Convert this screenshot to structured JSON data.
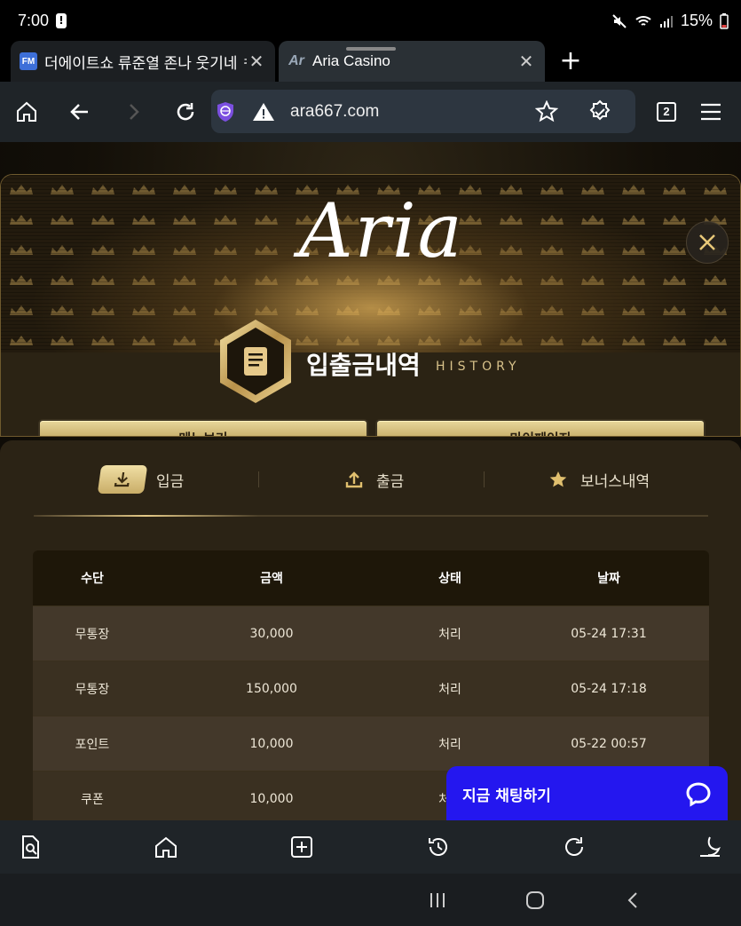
{
  "status_bar": {
    "time": "7:00",
    "battery": "15%",
    "icons": [
      "alert-icon",
      "mute-icon",
      "wifi-icon",
      "signal-icon",
      "battery-icon"
    ]
  },
  "browser": {
    "tabs": [
      {
        "favicon": "FM",
        "title": "더에이트쇼 류준열 존나 웃기네 ㅋ",
        "active": false
      },
      {
        "favicon": "Ar",
        "title": "Aria Casino",
        "active": true
      }
    ],
    "url": "ara667.com",
    "tab_count": "2"
  },
  "page": {
    "logo": "Aria",
    "title": "입출금내역",
    "subtitle": "HISTORY",
    "buttons": {
      "menu": "메뉴보기",
      "mypage": "마이페이지"
    },
    "tabs": [
      {
        "label": "입금",
        "icon": "download-icon",
        "active": true
      },
      {
        "label": "출금",
        "icon": "upload-icon",
        "active": false
      },
      {
        "label": "보너스내역",
        "icon": "star-icon",
        "active": false
      }
    ],
    "table": {
      "headers": [
        "수단",
        "금액",
        "상태",
        "날짜"
      ],
      "rows": [
        [
          "무통장",
          "30,000",
          "처리",
          "05-24 17:31"
        ],
        [
          "무통장",
          "150,000",
          "처리",
          "05-24 17:18"
        ],
        [
          "포인트",
          "10,000",
          "처리",
          "05-22 00:57"
        ],
        [
          "쿠폰",
          "10,000",
          "처리",
          ""
        ]
      ]
    },
    "chat": {
      "label": "지금 채팅하기"
    }
  },
  "colors": {
    "gold": "#d8c28a",
    "panel": "#2b2315",
    "chat_blue": "#2417ef"
  }
}
